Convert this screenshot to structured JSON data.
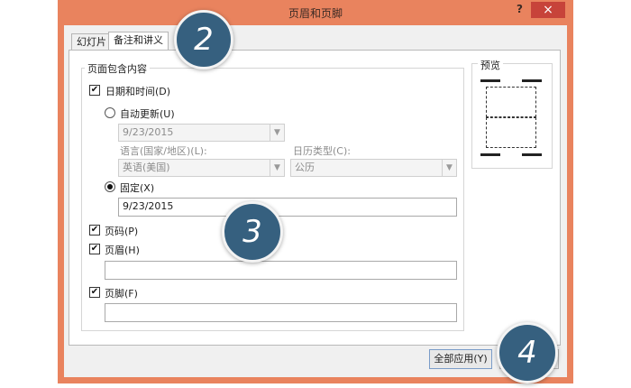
{
  "window": {
    "title": "页眉和页脚",
    "help_glyph": "?",
    "close_glyph": "×"
  },
  "tabs": [
    {
      "label": "幻灯片",
      "active": false
    },
    {
      "label": "备注和讲义",
      "active": true
    }
  ],
  "group": {
    "title": "页面包含内容",
    "date_time": {
      "label": "日期和时间(D)",
      "checked": true
    },
    "auto_update": {
      "label": "自动更新(U)",
      "selected": false,
      "value": "9/23/2015"
    },
    "language": {
      "label": "语言(国家/地区)(L):",
      "value": "英语(美国)"
    },
    "calendar": {
      "label": "日历类型(C):",
      "value": "公历"
    },
    "fixed": {
      "label": "固定(X)",
      "selected": true,
      "value": "9/23/2015"
    },
    "page_number": {
      "label": "页码(P)",
      "checked": true
    },
    "header": {
      "label": "页眉(H)",
      "checked": true,
      "value": ""
    },
    "footer": {
      "label": "页脚(F)",
      "checked": true,
      "value": ""
    }
  },
  "preview": {
    "title": "预览"
  },
  "buttons": {
    "apply_all": "全部应用(Y)"
  },
  "callouts": [
    "2",
    "3",
    "4"
  ],
  "check_glyph": "✔",
  "dropdown_glyph": "▼"
}
